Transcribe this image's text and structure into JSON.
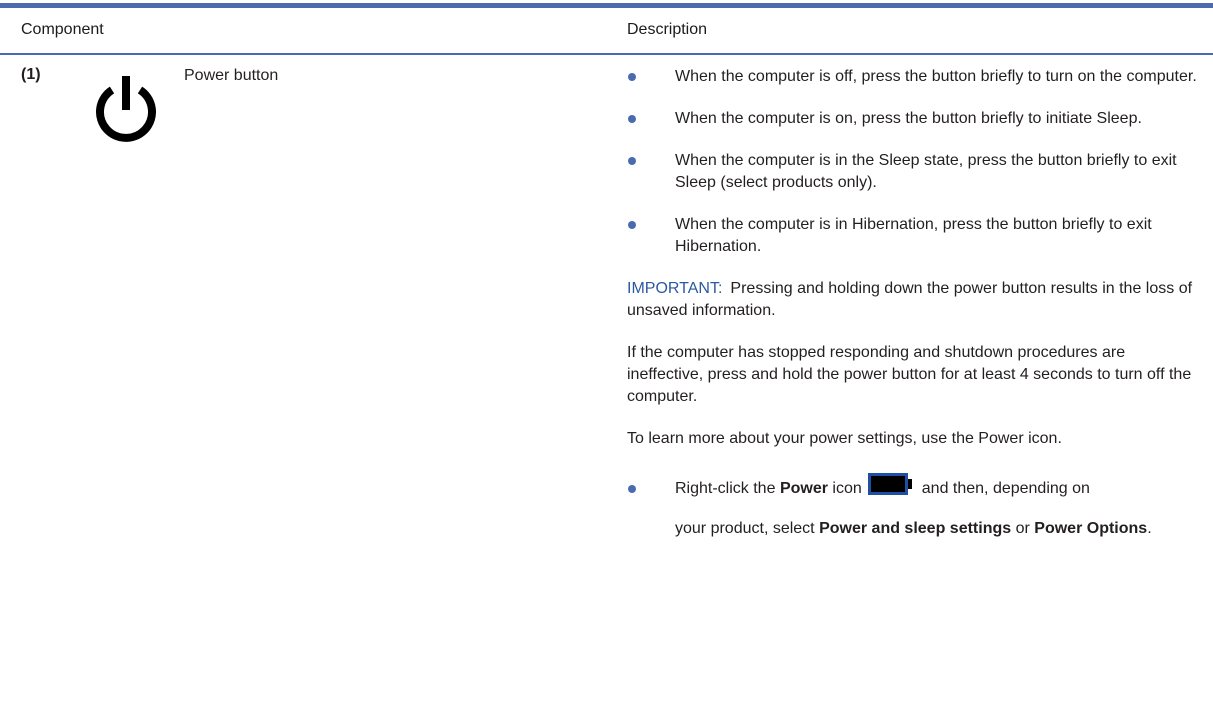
{
  "table": {
    "headers": {
      "component": "Component",
      "description": "Description"
    },
    "row": {
      "callout": "(1)",
      "icon": "power-icon",
      "component_name": "Power button",
      "bullets": [
        "When the computer is off, press the button briefly to turn on the computer.",
        "When the computer is on, press the button briefly to initiate Sleep.",
        "When the computer is in the Sleep state, press the button briefly to exit Sleep (select products only).",
        "When the computer is in Hibernation, press the button briefly to exit Hibernation."
      ],
      "important": {
        "label": "IMPORTANT:",
        "text": "Pressing and holding down the power button results in the loss of unsaved information."
      },
      "para_unresponsive": "If the computer has stopped responding and shutdown procedures are ineffective, press and hold the power button for at least 4 seconds to turn off the computer.",
      "para_learn_more": "To learn more about your power settings, use the Power icon.",
      "last_bullet": {
        "part1": "Right-click the",
        "power_bold": "Power",
        "part2": "icon",
        "part3": "and then, depending on",
        "part4": "your product, select",
        "option1": "Power and sleep settings",
        "part5": "or",
        "option2": "Power Options",
        "part6": ".",
        "icon": "battery-icon"
      }
    }
  },
  "colors": {
    "accent": "#4a6bb0",
    "important": "#2c5aa0",
    "text": "#231f20"
  }
}
